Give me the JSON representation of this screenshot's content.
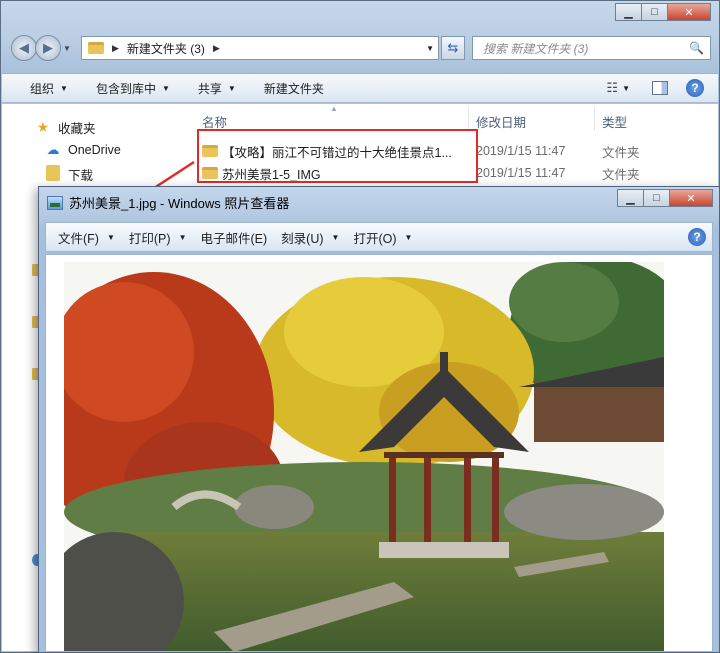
{
  "explorer": {
    "breadcrumb": "新建文件夹 (3)",
    "search_placeholder": "搜索 新建文件夹 (3)",
    "toolbar": {
      "organize": "组织",
      "include_library": "包含到库中",
      "share": "共享",
      "new_folder": "新建文件夹"
    },
    "nav": {
      "favorites": "收藏夹",
      "onedrive": "OneDrive",
      "downloads": "下载"
    },
    "columns": {
      "name": "名称",
      "date": "修改日期",
      "type": "类型"
    },
    "files": [
      {
        "name": "【攻略】丽江不可错过的十大绝佳景点1...",
        "date": "2019/1/15 11:47",
        "type": "文件夹"
      },
      {
        "name": "苏州美景1-5_IMG",
        "date": "2019/1/15 11:47",
        "type": "文件夹"
      }
    ]
  },
  "viewer": {
    "title": "苏州美景_1.jpg - Windows 照片查看器",
    "menu": {
      "file": "文件(F)",
      "print": "打印(P)",
      "email": "电子邮件(E)",
      "burn": "刻录(U)",
      "open": "打开(O)"
    }
  },
  "colors": {
    "highlight": "#e02a2a",
    "window_frame": "#b3c9e2"
  },
  "icons": [
    "back-icon",
    "forward-icon",
    "folder-icon",
    "refresh-icon",
    "search-icon",
    "star-icon",
    "cloud-icon",
    "help-icon",
    "minimize-icon",
    "maximize-icon",
    "close-icon"
  ]
}
